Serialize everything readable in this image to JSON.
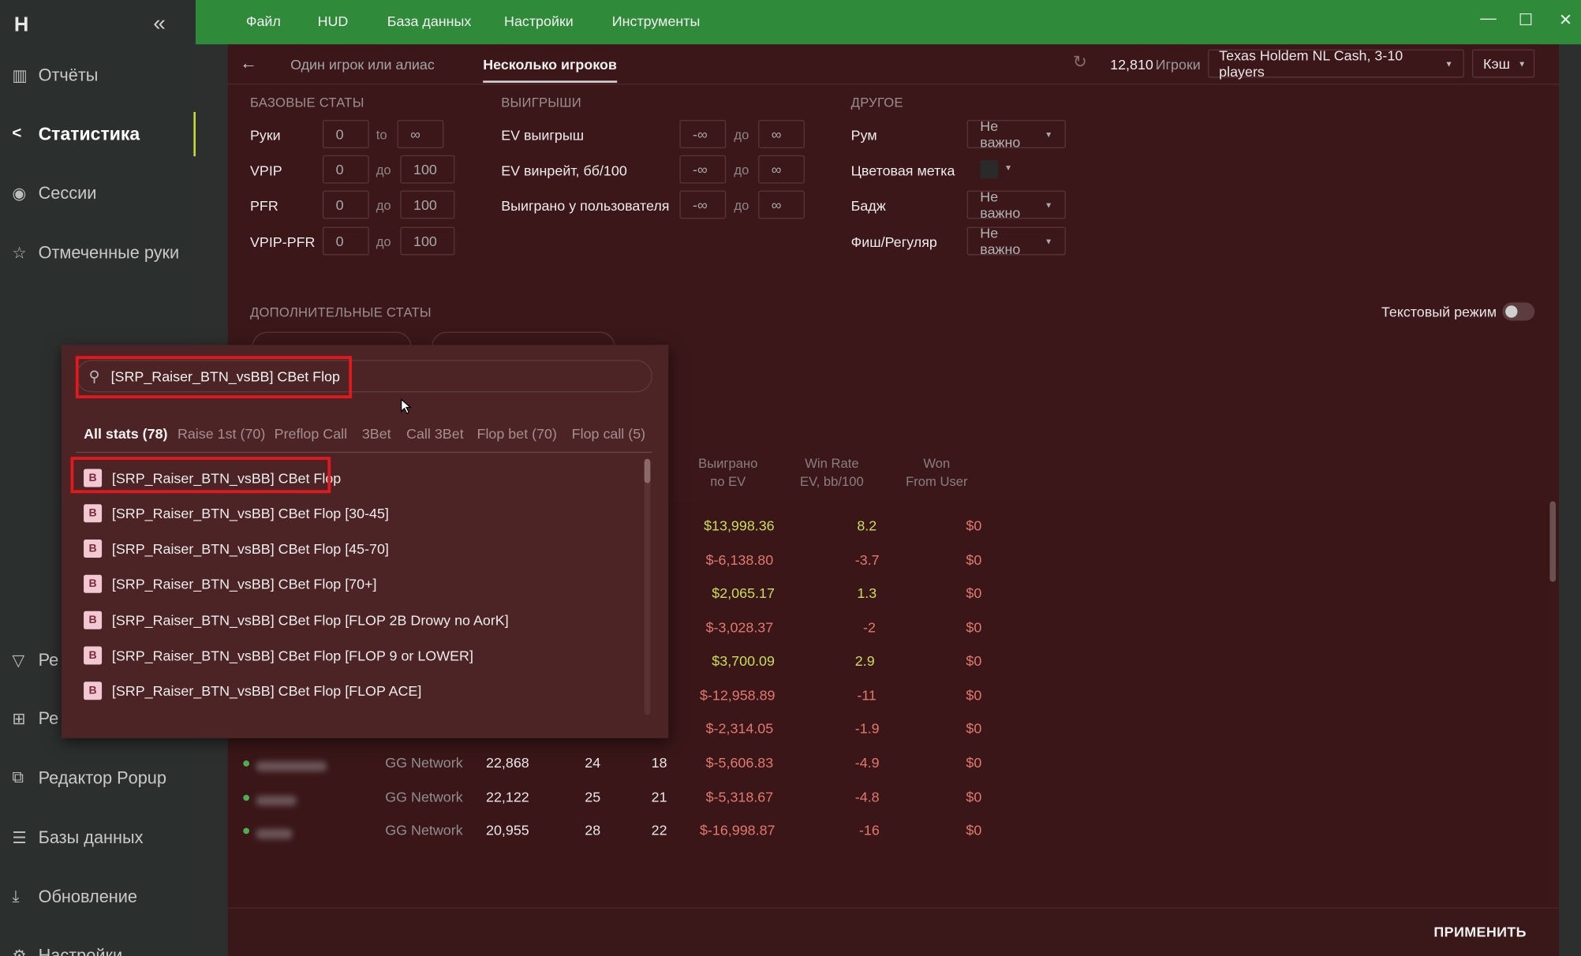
{
  "app": {
    "logo": "H",
    "collapse_glyph": "«"
  },
  "sidebar": {
    "items": [
      {
        "label": "Отчёты",
        "icon": "reports-icon",
        "glyph": "▥"
      },
      {
        "label": "Статистика",
        "icon": "share-nodes-icon",
        "glyph": "<",
        "active": true
      },
      {
        "label": "Сессии",
        "icon": "broadcast-icon",
        "glyph": "◉"
      },
      {
        "label": "Отмеченные руки",
        "icon": "star-list-icon",
        "glyph": "☆"
      },
      {
        "label": "Ре",
        "icon": "filter-icon",
        "glyph": "▽"
      },
      {
        "label": "Ре",
        "icon": "layout-icon",
        "glyph": "⊞"
      },
      {
        "label": "Редактор Popup",
        "icon": "popup-icon",
        "glyph": "⧉"
      },
      {
        "label": "Базы данных",
        "icon": "database-icon",
        "glyph": "☰"
      },
      {
        "label": "Обновление",
        "icon": "download-icon",
        "glyph": "⤓"
      },
      {
        "label": "Настройки",
        "icon": "gear-icon",
        "glyph": "⚙"
      }
    ]
  },
  "menubar": {
    "items": [
      "Файл",
      "HUD",
      "База данных",
      "Настройки",
      "Инструменты"
    ]
  },
  "window_controls": {
    "minimize": "—",
    "maximize": "☐",
    "close": "✕"
  },
  "tabs": {
    "back_glyph": "←",
    "single": "Один игрок или алиас",
    "multi": "Несколько игроков"
  },
  "header": {
    "refresh_glyph": "↻",
    "players_count": "12,810",
    "players_label": "Игроки",
    "game_select": "Texas Holdem NL Cash, 3-10 players",
    "mode_select": "Кэш"
  },
  "filters": {
    "base": {
      "title": "БАЗОВЫЕ СТАТЫ",
      "rows": [
        {
          "label": "Руки",
          "from": "0",
          "sep": "to",
          "to": "∞"
        },
        {
          "label": "VPIP",
          "from": "0",
          "sep": "до",
          "to": "100"
        },
        {
          "label": "PFR",
          "from": "0",
          "sep": "до",
          "to": "100"
        },
        {
          "label": "VPIP-PFR",
          "from": "0",
          "sep": "до",
          "to": "100"
        }
      ]
    },
    "winnings": {
      "title": "ВЫИГРЫШИ",
      "rows": [
        {
          "label": "EV выигрыш",
          "from": "-∞",
          "sep": "до",
          "to": "∞"
        },
        {
          "label": "EV винрейт, бб/100",
          "from": "-∞",
          "sep": "до",
          "to": "∞"
        },
        {
          "label": "Выиграно у пользователя",
          "from": "-∞",
          "sep": "до",
          "to": "∞"
        }
      ]
    },
    "other": {
      "title": "ДРУГОЕ",
      "rows": [
        {
          "label": "Рум",
          "value": "Не важно"
        },
        {
          "label": "Цветовая метка",
          "value": ""
        },
        {
          "label": "Бадж",
          "value": "Не важно"
        },
        {
          "label": "Фиш/Регуляр",
          "value": "Не важно"
        }
      ]
    },
    "extra_title": "ДОПОЛНИТЕЛЬНЫЕ СТАТЫ",
    "text_mode_label": "Текстовый режим",
    "text_mode_on": false
  },
  "table": {
    "headers": [
      {
        "l1": "Выиграно",
        "l2": "по EV"
      },
      {
        "l1": "Win Rate",
        "l2": "EV, bb/100"
      },
      {
        "l1": "Won",
        "l2": "From User"
      }
    ],
    "rows": [
      {
        "ev": "$13,998.36",
        "wr": "8.2",
        "won": "$0",
        "pos": true
      },
      {
        "ev": "$-6,138.80",
        "wr": "-3.7",
        "won": "$0",
        "pos": false
      },
      {
        "ev": "$2,065.17",
        "wr": "1.3",
        "won": "$0",
        "pos": true
      },
      {
        "ev": "$-3,028.37",
        "wr": "-2",
        "won": "$0",
        "pos": false
      },
      {
        "ev": "$3,700.09",
        "wr": "2.9",
        "won": "$0",
        "pos": true
      },
      {
        "ev": "$-12,958.89",
        "wr": "-11",
        "won": "$0",
        "pos": false
      },
      {
        "ev": "$-2,314.05",
        "wr": "-1.9",
        "won": "$0",
        "pos": false
      },
      {
        "network": "GG Network",
        "hands": "22,868",
        "vpip": "24",
        "pfr": "18",
        "ev": "$-5,606.83",
        "wr": "-4.9",
        "won": "$0",
        "pos": false
      },
      {
        "network": "GG Network",
        "hands": "22,122",
        "vpip": "25",
        "pfr": "21",
        "ev": "$-5,318.67",
        "wr": "-4.8",
        "won": "$0",
        "pos": false
      },
      {
        "network": "GG Network",
        "hands": "20,955",
        "vpip": "28",
        "pfr": "22",
        "ev": "$-16,998.87",
        "wr": "-16",
        "won": "$0",
        "pos": false
      }
    ]
  },
  "popup": {
    "search_value": "[SRP_Raiser_BTN_vsBB] CBet Flop",
    "tabs": [
      "All stats (78)",
      "Raise 1st (70)",
      "Preflop Call",
      "3Bet",
      "Call 3Bet",
      "Flop bet (70)",
      "Flop call (5)"
    ],
    "badge": "B",
    "items": [
      "[SRP_Raiser_BTN_vsBB] CBet Flop",
      "[SRP_Raiser_BTN_vsBB] CBet Flop [30-45]",
      "[SRP_Raiser_BTN_vsBB] CBet Flop [45-70]",
      "[SRP_Raiser_BTN_vsBB] CBet Flop [70+]",
      "[SRP_Raiser_BTN_vsBB] CBet Flop [FLOP 2B Drowy no AorK]",
      "[SRP_Raiser_BTN_vsBB] CBet Flop [FLOP 9 or LOWER]",
      "[SRP_Raiser_BTN_vsBB] CBet Flop [FLOP ACE]"
    ]
  },
  "footer": {
    "apply": "ПРИМЕНИТЬ"
  },
  "colors": {
    "accent_green": "#2f8a3a",
    "panel": "#3b1719",
    "highlight": "#e0191f",
    "positive": "#c9df5b",
    "negative": "#e07a6e"
  }
}
